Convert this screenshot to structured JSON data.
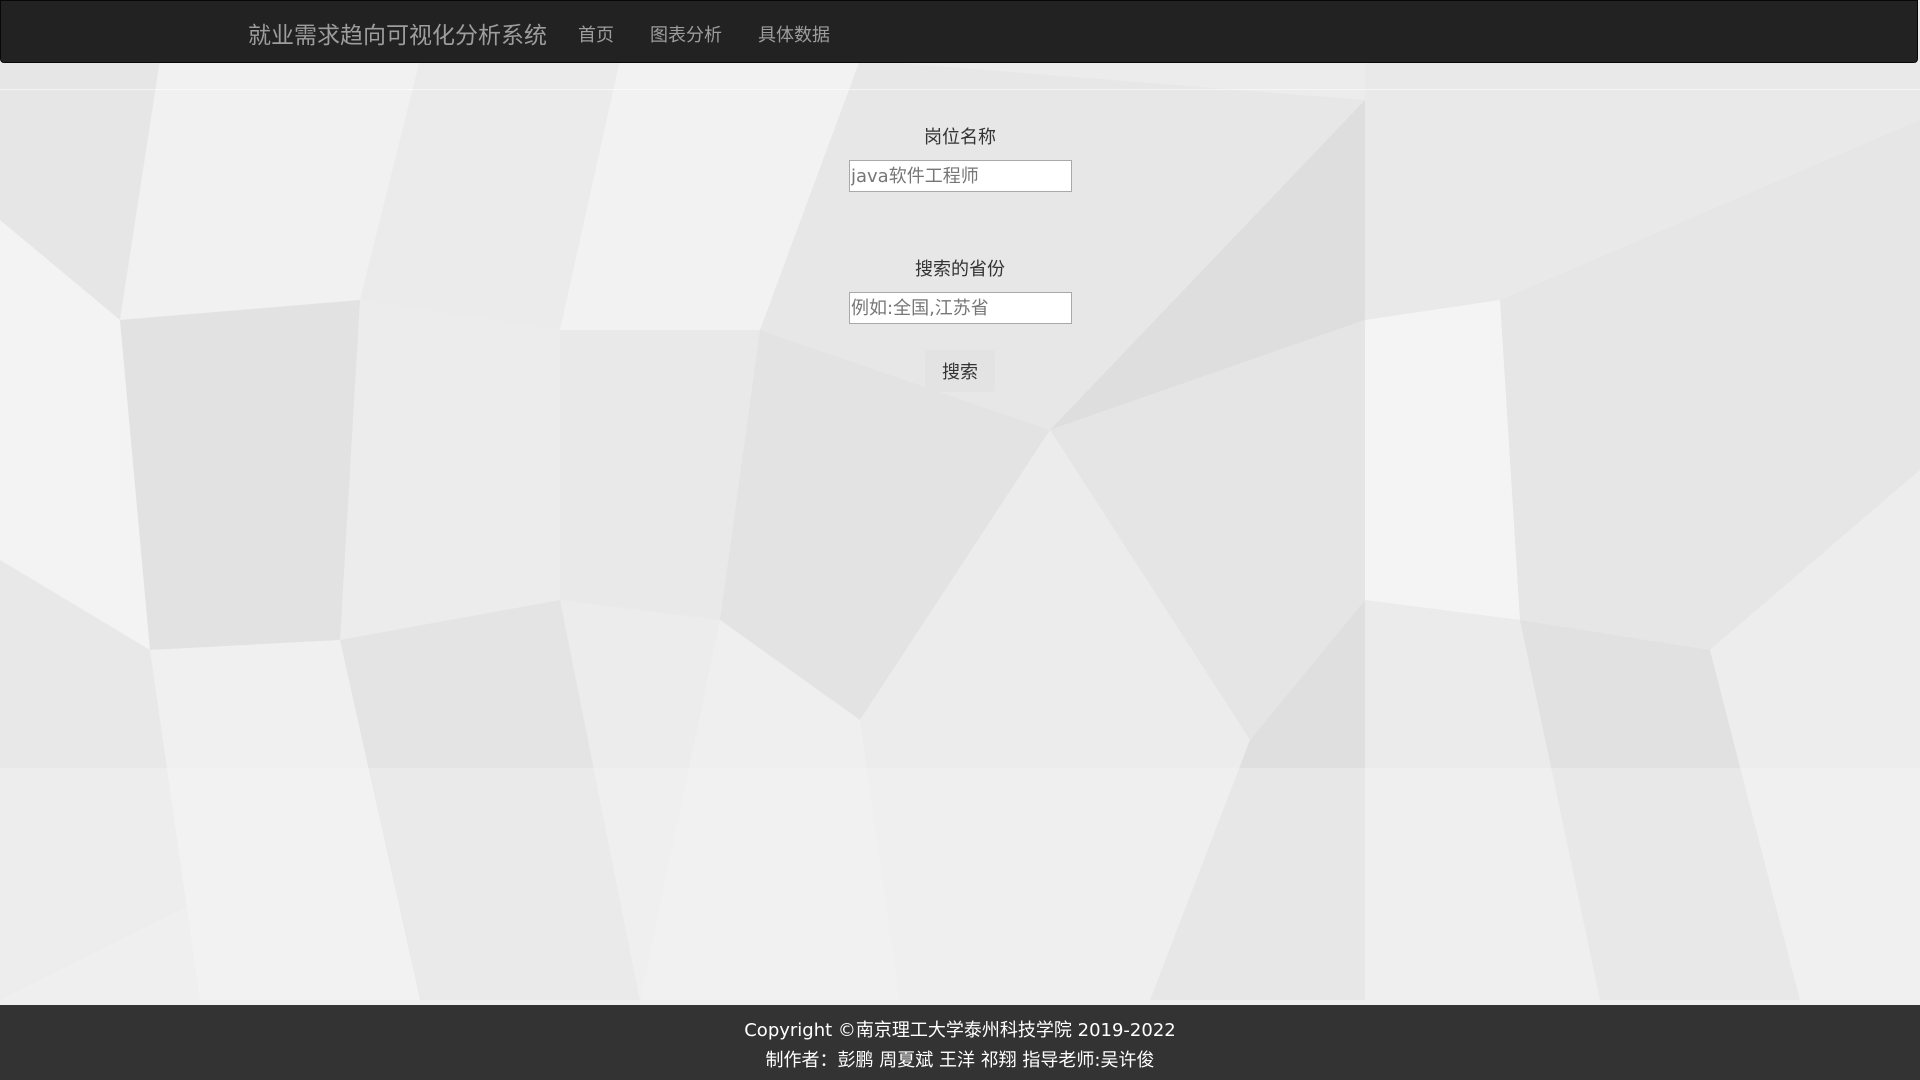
{
  "navbar": {
    "brand": "就业需求趋向可视化分析系统",
    "links": [
      {
        "label": "首页"
      },
      {
        "label": "图表分析"
      },
      {
        "label": "具体数据"
      }
    ]
  },
  "search_form": {
    "job_label": "岗位名称",
    "job_placeholder": "java软件工程师",
    "province_label": "搜索的省份",
    "province_placeholder": "例如:全国,江苏省",
    "submit_label": "搜索"
  },
  "footer": {
    "copyright": "Copyright ©南京理工大学泰州科技学院 2019-2022",
    "credits": "制作者：彭鹏 周夏斌 王洋 祁翔 指导老师:吴许俊"
  },
  "colors": {
    "navbar_bg": "#222222",
    "nav_text": "#9d9d9d",
    "footer_bg": "#333333",
    "page_bg": "#ececec"
  }
}
